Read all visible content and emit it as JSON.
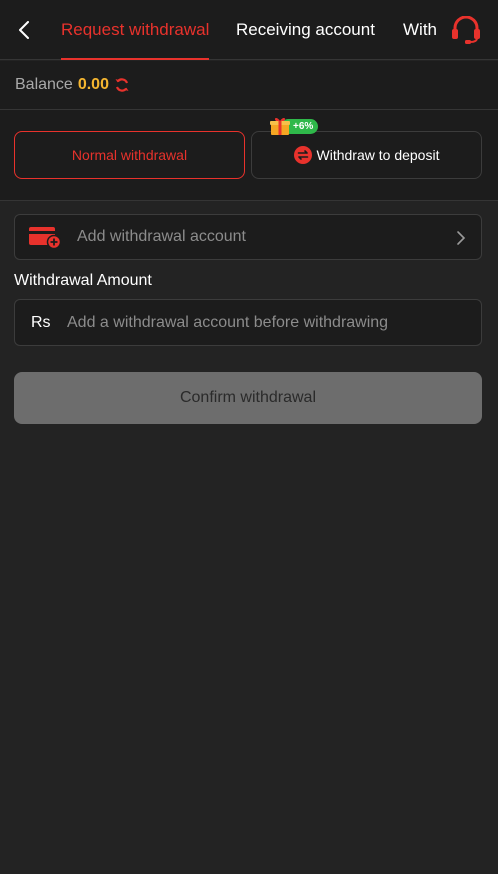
{
  "header": {
    "back_icon": "chevron-left-icon",
    "tabs": [
      {
        "label": "Request withdrawal",
        "active": true
      },
      {
        "label": "Receiving account",
        "active": false
      },
      {
        "label": "With",
        "active": false
      }
    ],
    "support_icon": "headset-icon"
  },
  "balance": {
    "label": "Balance",
    "value": "0.00",
    "refresh_icon": "refresh-icon"
  },
  "methods": {
    "normal_label": "Normal withdrawal",
    "deposit_label": "Withdraw to deposit",
    "promo_badge": "+6%"
  },
  "account": {
    "add_label": "Add withdrawal account"
  },
  "amount": {
    "title": "Withdrawal Amount",
    "currency": "Rs",
    "placeholder": "Add a withdrawal account before withdrawing"
  },
  "confirm_label": "Confirm withdrawal",
  "colors": {
    "accent": "#e8322c",
    "balance": "#f5b630",
    "promo": "#2fb84a",
    "background": "#232323",
    "button_disabled": "#6d6d6d"
  }
}
